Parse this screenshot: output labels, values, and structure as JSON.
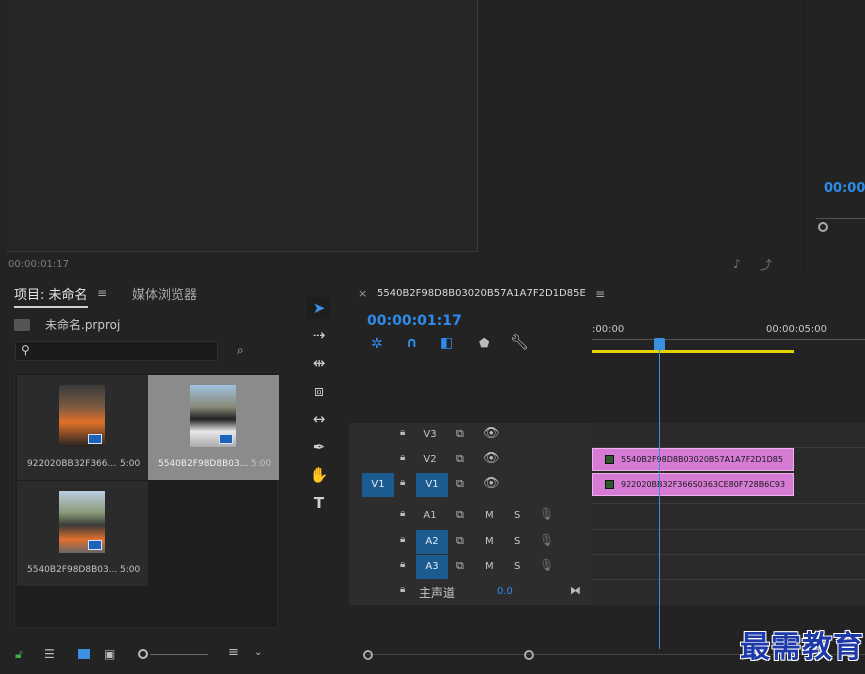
{
  "source_monitor": {
    "timecode": "00:00:01:17"
  },
  "program_monitor": {
    "timecode": "00:00"
  },
  "project_panel": {
    "tabs": [
      {
        "label": "项目: 未命名",
        "active": true
      },
      {
        "label": "媒体浏览器",
        "active": false
      }
    ],
    "project_file": "未命名.prproj",
    "search_placeholder": "",
    "items": [
      {
        "name": "922020BB32F366...",
        "duration": "5:00",
        "selected": false
      },
      {
        "name": "5540B2F98D8B03...",
        "duration": "5:00",
        "selected": true
      },
      {
        "name": "5540B2F98D8B03...",
        "duration": "5:00",
        "selected": false
      }
    ]
  },
  "timeline": {
    "sequence_name": "5540B2F98D8B03020B57A1A7F2D1D85E",
    "close_label": "×",
    "timecode": "00:00:01:17",
    "ruler": {
      "start": ":00:00",
      "mark": "00:00:05:00"
    },
    "video_tracks": [
      {
        "id": "V3",
        "target": "",
        "clip": ""
      },
      {
        "id": "V2",
        "target": "",
        "clip": "5540B2F98D8B03020B57A1A7F2D1D85"
      },
      {
        "id": "V1",
        "target": "V1",
        "clip": "922020BB32F366S0363CE80F728B6C93"
      }
    ],
    "audio_tracks": [
      {
        "id": "A1",
        "target": "",
        "m": "M",
        "s": "S"
      },
      {
        "id": "A2",
        "target": "A2",
        "m": "M",
        "s": "S"
      },
      {
        "id": "A3",
        "target": "A3",
        "m": "M",
        "s": "S"
      }
    ],
    "master": {
      "label": "主声道",
      "value": "0.0"
    }
  },
  "watermark": "最需教育",
  "colors": {
    "accent": "#2d8ceb",
    "clip": "#d57bd4",
    "track_target": "#1c5b8f",
    "work_area": "#e6d400"
  }
}
